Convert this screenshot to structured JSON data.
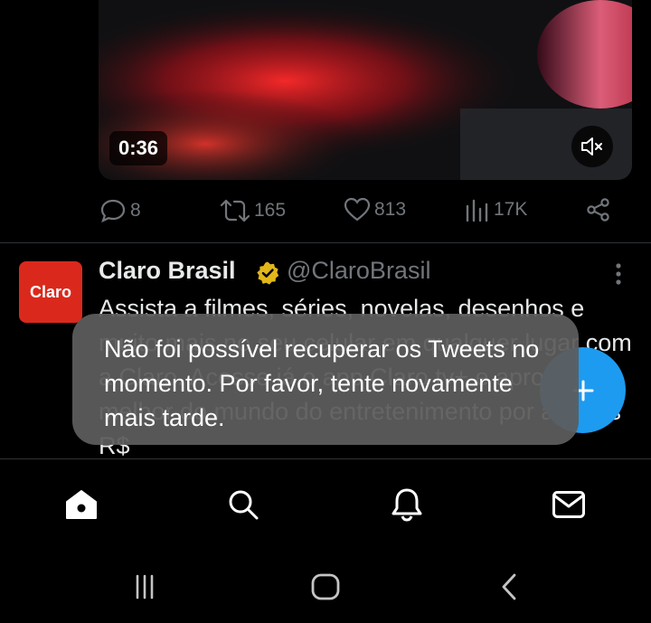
{
  "video": {
    "duration": "0:36",
    "mute_icon": "speaker-muted-icon"
  },
  "tweet_actions": {
    "replies": "8",
    "retweets": "165",
    "likes": "813",
    "views": "17K"
  },
  "ad_tweet": {
    "avatar_text": "Claro",
    "name": "Claro Brasil",
    "handle": "@ClaroBrasil",
    "text": "Assista a filmes, séries, novelas, desenhos e muito mais no seu celular em qualquer lugar com a Claro. Acesse já o app Claro tv+ e aproveite o melhor do mundo do entretenimento por apenas R$"
  },
  "toast": {
    "message": "Não foi possível recuperar os Tweets no momento. Por favor, tente novamente mais tarde."
  },
  "colors": {
    "accent": "#1d9bf0",
    "claro_red": "#da291c",
    "muted": "#71767b"
  }
}
